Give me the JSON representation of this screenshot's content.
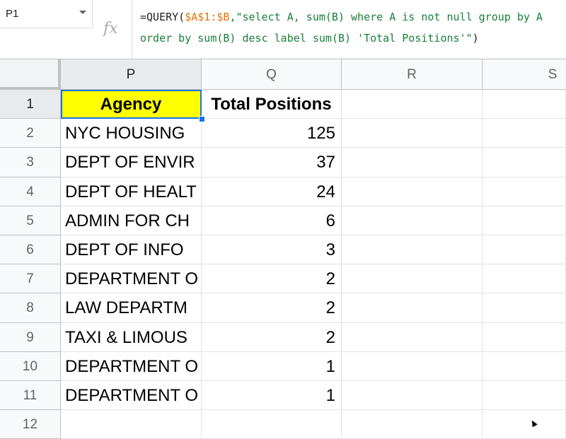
{
  "name_box": {
    "value": "P1"
  },
  "formula": {
    "prefix": "=QUERY(",
    "range_ref": "$A$1:$B",
    "query_string": ",\"select A, sum(B) where A is not null group by A order by sum(B) desc label sum(B) 'Total Positions'\"",
    "suffix": ")"
  },
  "fx_icon": "function-icon",
  "columns": [
    "P",
    "Q",
    "R",
    "S"
  ],
  "rows": [
    "1",
    "2",
    "3",
    "4",
    "5",
    "6",
    "7",
    "8",
    "9",
    "10",
    "11",
    "12"
  ],
  "table": {
    "headers": {
      "agency": "Agency",
      "total": "Total Positions"
    },
    "rows": [
      {
        "agency": "NYC HOUSING",
        "total": "125"
      },
      {
        "agency": "DEPT OF ENVIR",
        "total": "37"
      },
      {
        "agency": "DEPT OF HEALT",
        "total": "24"
      },
      {
        "agency": "ADMIN FOR CH",
        "total": "6"
      },
      {
        "agency": "DEPT OF INFO",
        "total": "3"
      },
      {
        "agency": "DEPARTMENT O",
        "total": "2"
      },
      {
        "agency": "LAW DEPARTM",
        "total": "2"
      },
      {
        "agency": "TAXI & LIMOUS",
        "total": "2"
      },
      {
        "agency": "DEPARTMENT O",
        "total": "1"
      },
      {
        "agency": "DEPARTMENT O",
        "total": "1"
      }
    ]
  },
  "colors": {
    "header_fill": "#ffff00",
    "selection": "#1a73e8",
    "formula_string": "#188038",
    "formula_ref": "#e8710a"
  }
}
